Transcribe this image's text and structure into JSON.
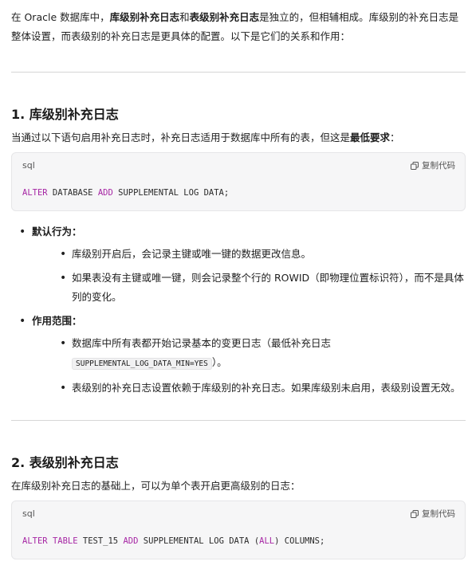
{
  "intro": {
    "p1": "在 Oracle 数据库中，",
    "b1": "库级别补充日志",
    "p2": "和",
    "b2": "表级别补充日志",
    "p3": "是独立的，但相辅相成。库级别的补充日志是整体设置，而表级别的补充日志是更具体的配置。以下是它们的关系和作用："
  },
  "section1": {
    "title": "1. 库级别补充日志",
    "lead_text": "当通过以下语句启用补充日志时，补充日志适用于数据库中所有的表，但这是",
    "lead_bold": "最低要求",
    "lead_end": "：",
    "code": {
      "lang": "sql",
      "copy_label": "复制代码",
      "kw1": "ALTER",
      "t1": " DATABASE ",
      "kw2": "ADD",
      "t2": " SUPPLEMENTAL LOG DATA;"
    },
    "items": [
      {
        "label": "默认行为：",
        "subs": [
          "库级别开启后，会记录主键或唯一键的数据更改信息。",
          "如果表没有主键或唯一键，则会记录整个行的 ROWID（即物理位置标识符），而不是具体列的变化。"
        ]
      },
      {
        "label": "作用范围：",
        "sub1_text": "数据库中所有表都开始记录基本的变更日志（最低补充日志",
        "sub1_code": "SUPPLEMENTAL_LOG_DATA_MIN=YES",
        "sub1_end": "）。",
        "sub2": "表级别的补充日志设置依赖于库级别的补充日志。如果库级别未启用，表级别设置无效。"
      }
    ]
  },
  "section2": {
    "title": "2. 表级别补充日志",
    "lead_text": "在库级别补充日志的基础上，可以为单个表开启更高级别的日志：",
    "code": {
      "lang": "sql",
      "copy_label": "复制代码",
      "kw1": "ALTER",
      "t1": " ",
      "kw2": "TABLE",
      "t2": " TEST_15 ",
      "kw3": "ADD",
      "t3": " SUPPLEMENTAL LOG DATA (",
      "kw4": "ALL",
      "t4": ") COLUMNS;"
    }
  }
}
